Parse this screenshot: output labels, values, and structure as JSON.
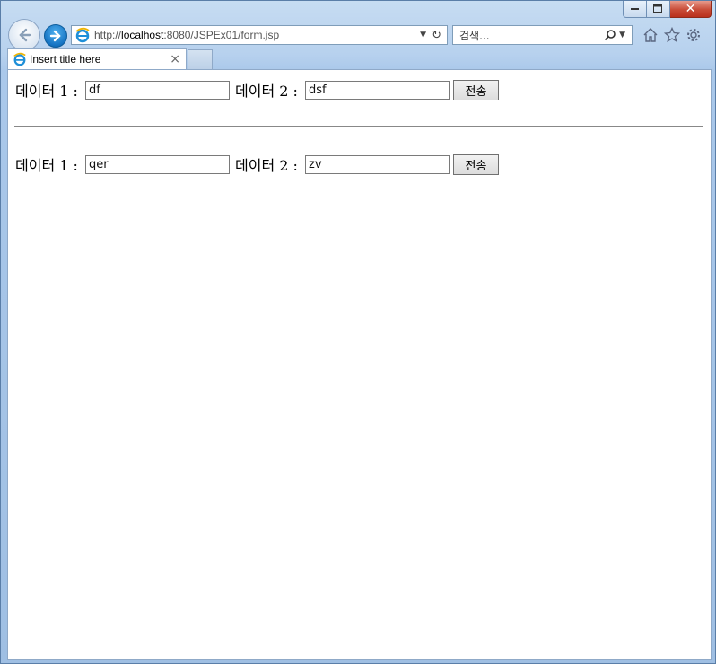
{
  "browser": {
    "url_prefix": "http://",
    "url_host": "localhost",
    "url_rest": ":8080/JSPEx01/form.jsp",
    "search_placeholder": "검색...",
    "tab_title": "Insert title here",
    "tab_close": "×"
  },
  "window_controls": {
    "close": "✕"
  },
  "forms": [
    {
      "label1": "데이터 1 : ",
      "value1": "df",
      "label2": "데이터 2 : ",
      "value2": "dsf",
      "submit": "전송"
    },
    {
      "label1": "데이터 1 : ",
      "value1": "qer",
      "label2": "데이터 2 : ",
      "value2": "zv",
      "submit": "전송"
    }
  ],
  "icons": [
    "back-icon",
    "forward-icon",
    "ie-logo-icon",
    "refresh-icon",
    "search-icon",
    "home-icon",
    "star-icon",
    "gear-icon"
  ]
}
